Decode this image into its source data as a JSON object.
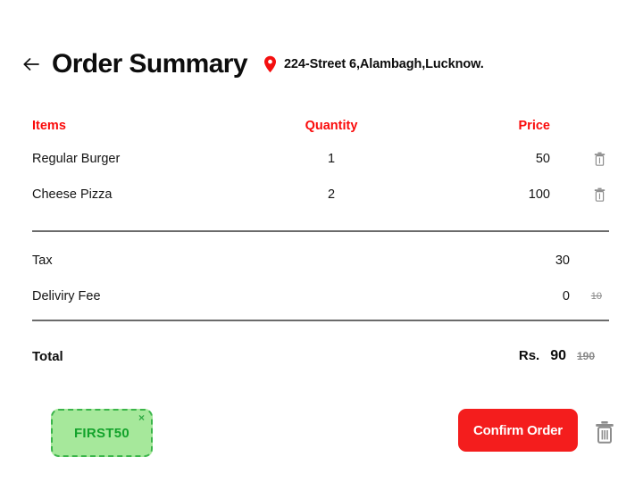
{
  "header": {
    "back_icon": "arrow-left-icon",
    "title": "Order Summary",
    "pin_icon": "location-pin-icon",
    "address": "224-Street 6,Alambagh,Lucknow."
  },
  "table": {
    "columns": {
      "items": "Items",
      "quantity": "Quantity",
      "price": "Price"
    },
    "rows": [
      {
        "item": "Regular Burger",
        "quantity": "1",
        "price": "50",
        "delete_icon": "trash-icon"
      },
      {
        "item": "Cheese Pizza",
        "quantity": "2",
        "price": "100",
        "delete_icon": "trash-icon"
      }
    ]
  },
  "fees": [
    {
      "label": "Tax",
      "value": "30",
      "original": ""
    },
    {
      "label": "Deliviry Fee",
      "value": "0",
      "original": "10"
    }
  ],
  "total": {
    "label": "Total",
    "currency": "Rs.",
    "amount": "90",
    "original": "190"
  },
  "coupon": {
    "code": "FIRST50",
    "remove_icon": "close-icon",
    "remove_label": "×"
  },
  "actions": {
    "confirm_label": "Confirm Order",
    "clear_cart_icon": "trash-icon"
  },
  "colors": {
    "accent_red": "#fa0a0a",
    "button_red": "#f41d1d",
    "coupon_green_bg": "#a6e89b",
    "coupon_green_text": "#13a32b",
    "coupon_green_border": "#3bb54a",
    "muted_gray": "#8a8a8a",
    "divider_gray": "#6b6b6b",
    "text_black": "#141414"
  }
}
